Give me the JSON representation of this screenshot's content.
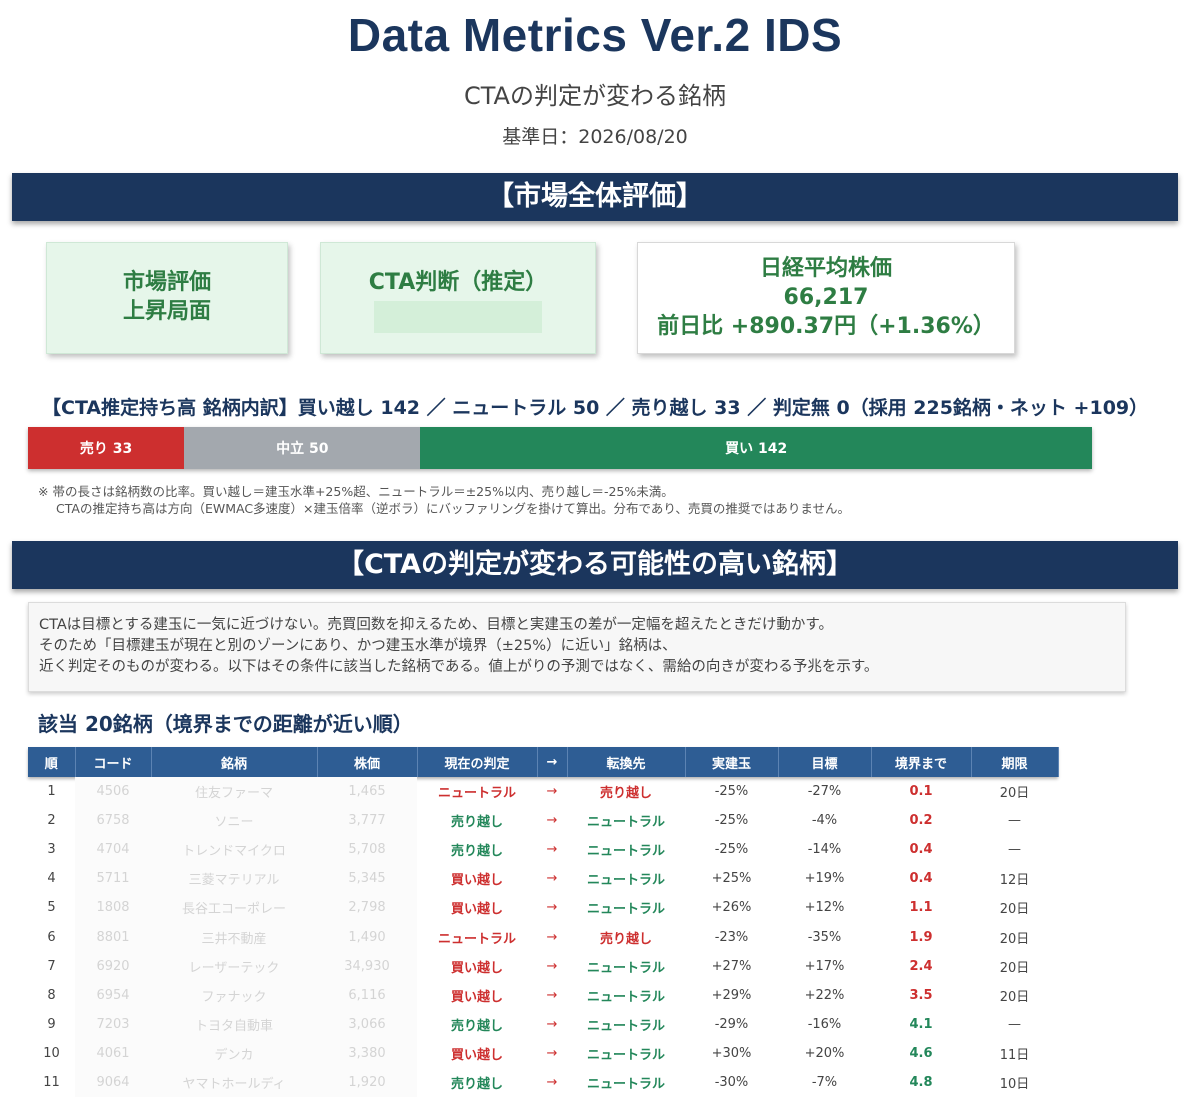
{
  "header": {
    "title": "Data Metrics Ver.2 IDS",
    "subtitle": "CTAの判定が変わる銘柄",
    "base_date": "基準日：2026/08/20"
  },
  "market": {
    "banner": "【市場全体評価】",
    "eval_label": "市場評価",
    "eval_value": "上昇局面",
    "cta_label": "CTA判断（推定）",
    "nikkei_label": "日経平均株価",
    "nikkei_value": "66,217",
    "nikkei_change": "前日比 +890.37円（+1.36%）"
  },
  "breakdown": {
    "heading": "【CTA推定持ち高 銘柄内訳】買い越し 142 ／ ニュートラル 50 ／ 売り越し 33 ／ 判定無 0（採用 225銘柄・ネット +109）",
    "sell_label": "売り 33",
    "neutral_label": "中立 50",
    "buy_label": "買い 142",
    "sell_count": 33,
    "neutral_count": 50,
    "buy_count": 142,
    "note1": "※ 帯の長さは銘柄数の比率。買い越し＝建玉水準+25%超、ニュートラル＝±25%以内、売り越し＝-25%未満。",
    "note2": "CTAの推定持ち高は方向（EWMAC多速度）×建玉倍率（逆ボラ）にバッファリングを掛けて算出。分布であり、売買の推奨ではありません。"
  },
  "section2": {
    "banner": "【CTAの判定が変わる可能性の高い銘柄】",
    "explain1": "CTAは目標とする建玉に一気に近づけない。売買回数を抑えるため、目標と実建玉の差が一定幅を超えたときだけ動かす。",
    "explain2": "そのため「目標建玉が現在と別のゾーンにあり、かつ建玉水準が境界（±25%）に近い」銘柄は、",
    "explain3": "近く判定そのものが変わる。以下はその条件に該当した銘柄である。値上がりの予測ではなく、需給の向きが変わる予兆を示す。",
    "count": "該当 20銘柄（境界までの距離が近い順）"
  },
  "table": {
    "headers": [
      "順",
      "コード",
      "銘柄",
      "株価",
      "現在の判定",
      "→",
      "転換先",
      "実建玉",
      "目標",
      "境界まで",
      "期限"
    ],
    "rows": [
      {
        "rank": "1",
        "code": "4506",
        "name": "住友ファーマ",
        "price": "1,465",
        "current": "ニュートラル",
        "arrow": "→",
        "next": "売り越し",
        "actual": "-25%",
        "target": "-27%",
        "dist": "0.1",
        "term": "20日"
      },
      {
        "rank": "2",
        "code": "6758",
        "name": "ソニー",
        "price": "3,777",
        "current": "売り越し",
        "arrow": "→",
        "next": "ニュートラル",
        "actual": "-25%",
        "target": "-4%",
        "dist": "0.2",
        "term": "—"
      },
      {
        "rank": "3",
        "code": "4704",
        "name": "トレンドマイクロ",
        "price": "5,708",
        "current": "売り越し",
        "arrow": "→",
        "next": "ニュートラル",
        "actual": "-25%",
        "target": "-14%",
        "dist": "0.4",
        "term": "—"
      },
      {
        "rank": "4",
        "code": "5711",
        "name": "三菱マテリアル",
        "price": "5,345",
        "current": "買い越し",
        "arrow": "→",
        "next": "ニュートラル",
        "actual": "+25%",
        "target": "+19%",
        "dist": "0.4",
        "term": "12日"
      },
      {
        "rank": "5",
        "code": "1808",
        "name": "長谷工コーポレー",
        "price": "2,798",
        "current": "買い越し",
        "arrow": "→",
        "next": "ニュートラル",
        "actual": "+26%",
        "target": "+12%",
        "dist": "1.1",
        "term": "20日"
      },
      {
        "rank": "6",
        "code": "8801",
        "name": "三井不動産",
        "price": "1,490",
        "current": "ニュートラル",
        "arrow": "→",
        "next": "売り越し",
        "actual": "-23%",
        "target": "-35%",
        "dist": "1.9",
        "term": "20日"
      },
      {
        "rank": "7",
        "code": "6920",
        "name": "レーザーテック",
        "price": "34,930",
        "current": "買い越し",
        "arrow": "→",
        "next": "ニュートラル",
        "actual": "+27%",
        "target": "+17%",
        "dist": "2.4",
        "term": "20日"
      },
      {
        "rank": "8",
        "code": "6954",
        "name": "ファナック",
        "price": "6,116",
        "current": "買い越し",
        "arrow": "→",
        "next": "ニュートラル",
        "actual": "+29%",
        "target": "+22%",
        "dist": "3.5",
        "term": "20日"
      },
      {
        "rank": "9",
        "code": "7203",
        "name": "トヨタ自動車",
        "price": "3,066",
        "current": "売り越し",
        "arrow": "→",
        "next": "ニュートラル",
        "actual": "-29%",
        "target": "-16%",
        "dist": "4.1",
        "term": "—"
      },
      {
        "rank": "10",
        "code": "4061",
        "name": "デンカ",
        "price": "3,380",
        "current": "買い越し",
        "arrow": "→",
        "next": "ニュートラル",
        "actual": "+30%",
        "target": "+20%",
        "dist": "4.6",
        "term": "11日"
      },
      {
        "rank": "11",
        "code": "9064",
        "name": "ヤマトホールディ",
        "price": "1,920",
        "current": "売り越し",
        "arrow": "→",
        "next": "ニュートラル",
        "actual": "-30%",
        "target": "-7%",
        "dist": "4.8",
        "term": "10日"
      }
    ]
  }
}
